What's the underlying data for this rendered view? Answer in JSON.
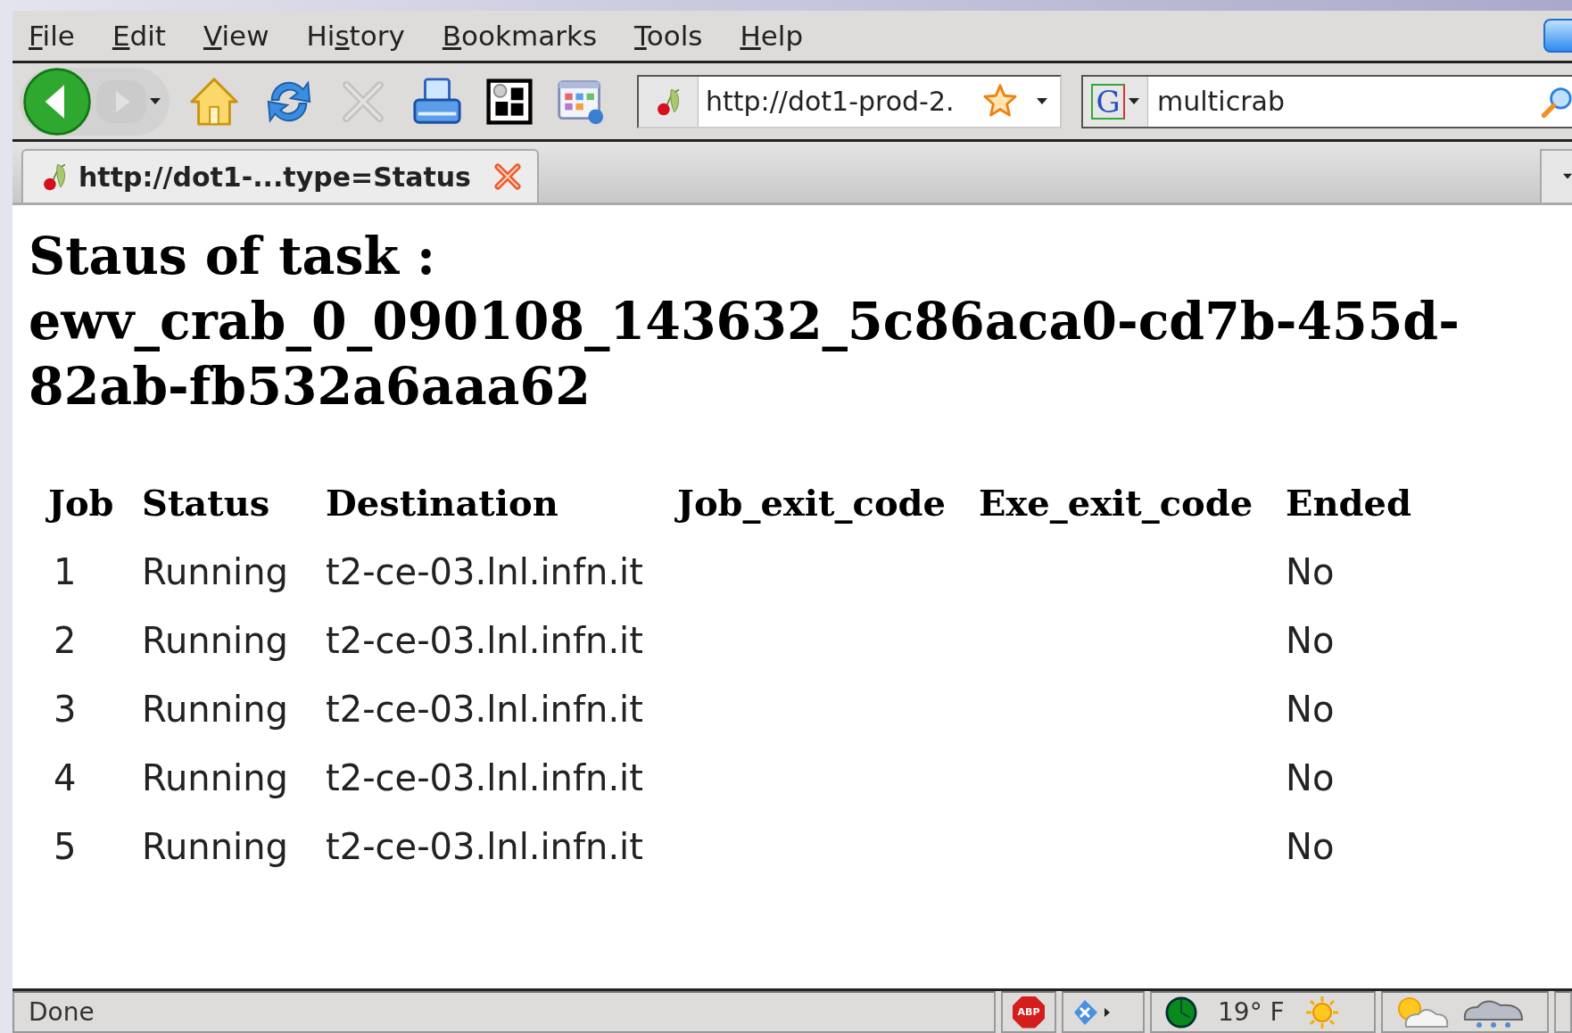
{
  "menu": [
    {
      "key": "F",
      "post": "ile"
    },
    {
      "key": "E",
      "post": "dit"
    },
    {
      "key": "V",
      "post": "iew"
    },
    {
      "pre": "Hi",
      "key": "s",
      "post": "tory"
    },
    {
      "key": "B",
      "post": "ookmarks"
    },
    {
      "key": "T",
      "post": "ools"
    },
    {
      "key": "H",
      "post": "elp"
    }
  ],
  "toolbar": [
    {
      "kind": "back",
      "disabled": false
    },
    {
      "kind": "forward",
      "disabled": true
    },
    {
      "kind": "history",
      "disabled": false
    },
    {
      "kind": "home",
      "disabled": false
    },
    {
      "kind": "reload",
      "disabled": false
    },
    {
      "kind": "stop",
      "disabled": true
    },
    {
      "kind": "print",
      "disabled": false
    },
    {
      "kind": "grid",
      "disabled": false
    },
    {
      "kind": "apps",
      "disabled": false
    }
  ],
  "url_bar": {
    "value": "http://dot1-prod-2."
  },
  "search_bar": {
    "engine": "G",
    "value": "multicrab"
  },
  "tabs": [
    {
      "title": "http://dot1-...type=Status",
      "selected": true
    }
  ],
  "page": {
    "heading": "Staus of task : ewv_crab_0_090108_143632_5c86aca0-cd7b-455d-82ab-fb532a6aaa62",
    "table": {
      "columns": [
        "Job",
        "Status",
        "Destination",
        "Job_exit_code",
        "Exe_exit_code",
        "Ended"
      ],
      "rows": [
        {
          "job": "1",
          "status": "Running",
          "destination": "t2-ce-03.lnl.infn.it",
          "ended": "No"
        },
        {
          "job": "2",
          "status": "Running",
          "destination": "t2-ce-03.lnl.infn.it",
          "ended": "No"
        },
        {
          "job": "3",
          "status": "Running",
          "destination": "t2-ce-03.lnl.infn.it",
          "ended": "No"
        },
        {
          "job": "4",
          "status": "Running",
          "destination": "t2-ce-03.lnl.infn.it",
          "ended": "No"
        },
        {
          "job": "5",
          "status": "Running",
          "destination": "t2-ce-03.lnl.infn.it",
          "ended": "No"
        }
      ]
    }
  },
  "status_bar": {
    "text": "Done",
    "adblock": "ABP",
    "temperature": "19° F"
  }
}
